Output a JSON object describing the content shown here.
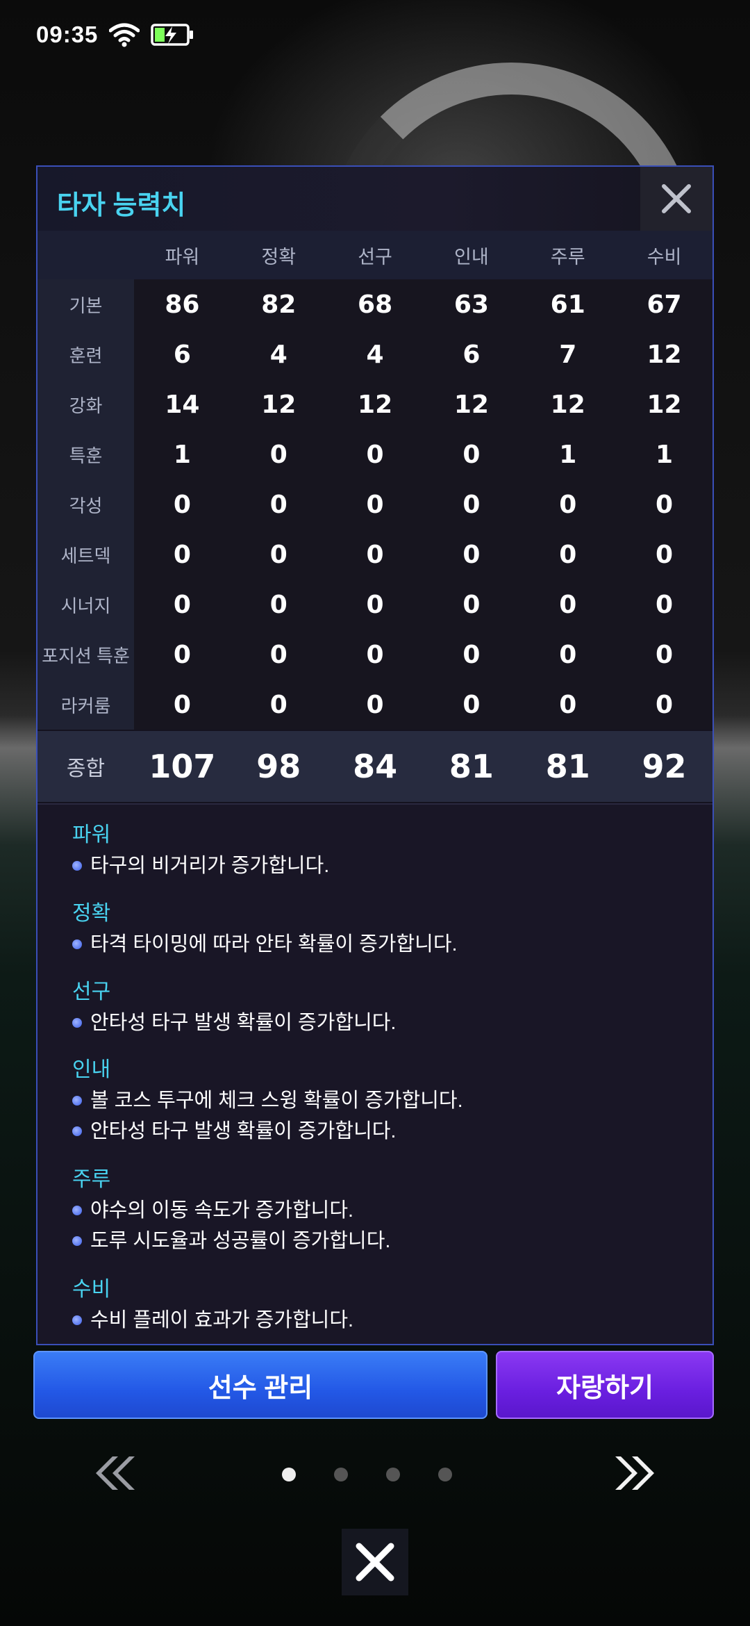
{
  "status_bar": {
    "time": "09:35"
  },
  "panel": {
    "title": "타자 능력치",
    "columns": [
      "파워",
      "정확",
      "선구",
      "인내",
      "주루",
      "수비"
    ],
    "rows": [
      {
        "label": "기본",
        "values": [
          "86",
          "82",
          "68",
          "63",
          "61",
          "67"
        ]
      },
      {
        "label": "훈련",
        "values": [
          "6",
          "4",
          "4",
          "6",
          "7",
          "12"
        ]
      },
      {
        "label": "강화",
        "values": [
          "14",
          "12",
          "12",
          "12",
          "12",
          "12"
        ]
      },
      {
        "label": "특훈",
        "values": [
          "1",
          "0",
          "0",
          "0",
          "1",
          "1"
        ]
      },
      {
        "label": "각성",
        "values": [
          "0",
          "0",
          "0",
          "0",
          "0",
          "0"
        ]
      },
      {
        "label": "세트덱",
        "values": [
          "0",
          "0",
          "0",
          "0",
          "0",
          "0"
        ]
      },
      {
        "label": "시너지",
        "values": [
          "0",
          "0",
          "0",
          "0",
          "0",
          "0"
        ]
      },
      {
        "label": "포지션 특훈",
        "values": [
          "0",
          "0",
          "0",
          "0",
          "0",
          "0"
        ]
      },
      {
        "label": "라커룸",
        "values": [
          "0",
          "0",
          "0",
          "0",
          "0",
          "0"
        ]
      }
    ],
    "total": {
      "label": "종합",
      "values": [
        "107",
        "98",
        "84",
        "81",
        "81",
        "92"
      ]
    },
    "descriptions": [
      {
        "title": "파워",
        "lines": [
          "타구의 비거리가 증가합니다."
        ]
      },
      {
        "title": "정확",
        "lines": [
          "타격 타이밍에 따라 안타 확률이 증가합니다."
        ]
      },
      {
        "title": "선구",
        "lines": [
          "안타성 타구 발생 확률이 증가합니다."
        ]
      },
      {
        "title": "인내",
        "lines": [
          "볼 코스 투구에 체크 스윙 확률이 증가합니다.",
          "안타성 타구 발생 확률이 증가합니다."
        ]
      },
      {
        "title": "주루",
        "lines": [
          "야수의 이동 속도가 증가합니다.",
          "도루 시도율과 성공률이 증가합니다."
        ]
      },
      {
        "title": "수비",
        "lines": [
          "수비 플레이 효과가 증가합니다."
        ]
      }
    ]
  },
  "buttons": {
    "manage": "선수 관리",
    "share": "자랑하기"
  },
  "pagination": {
    "current": 1,
    "total": 4
  },
  "colors": {
    "accent": "#49d3f0",
    "manage_button": "#2358e6",
    "share_button": "#6a1fe0",
    "panel_border": "#3a4fb8"
  }
}
